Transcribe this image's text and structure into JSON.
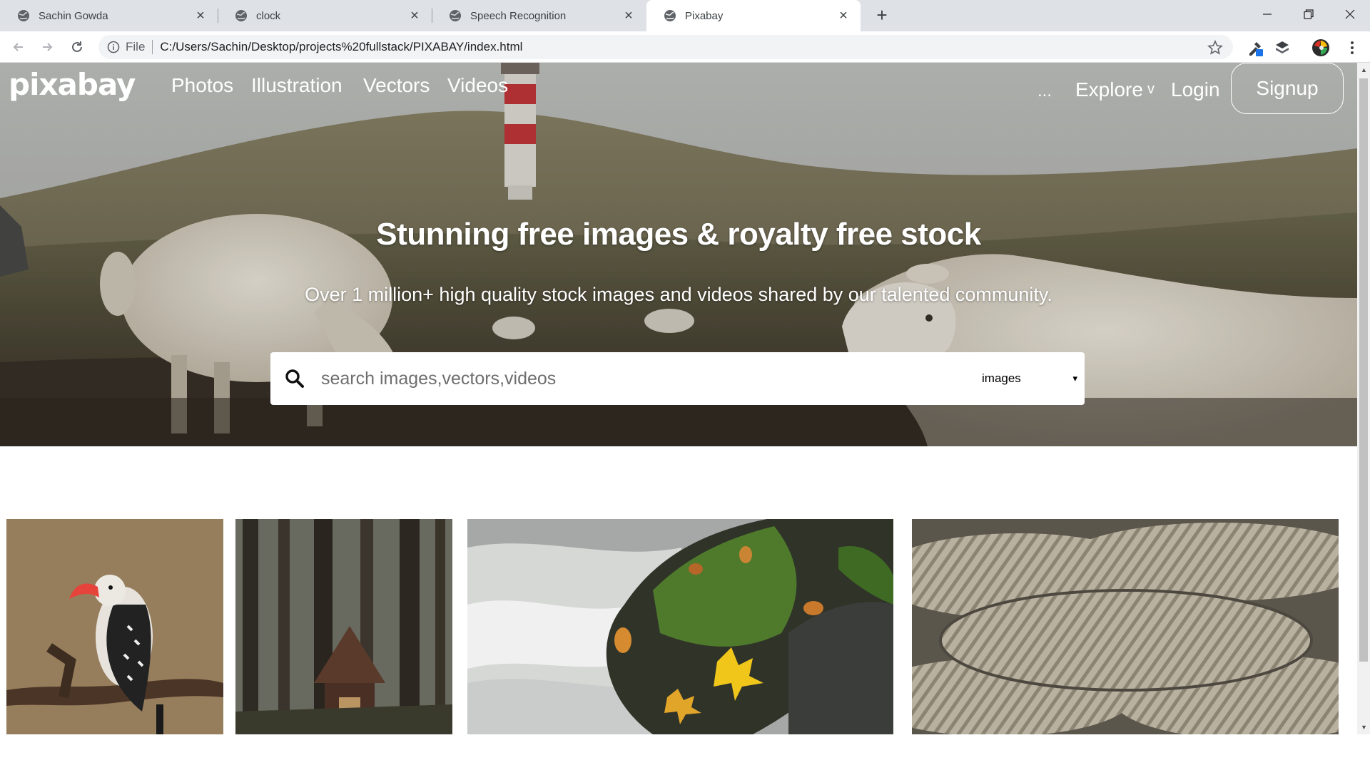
{
  "browser": {
    "tabs": [
      {
        "title": "Sachin Gowda",
        "active": false
      },
      {
        "title": "clock",
        "active": false
      },
      {
        "title": "Speech Recognition",
        "active": false
      },
      {
        "title": "Pixabay",
        "active": true
      }
    ],
    "address": {
      "scheme_label": "File",
      "url": "C:/Users/Sachin/Desktop/projects%20fullstack/PIXABAY/index.html"
    }
  },
  "page": {
    "logo": "pixabay",
    "nav": {
      "photos": "Photos",
      "illustration": "Illustration",
      "vectors": "Vectors",
      "videos": "Videos",
      "more": "...",
      "explore": "Explore",
      "explore_caret": "v",
      "login": "Login",
      "signup": "Signup"
    },
    "hero": {
      "title": "Stunning free images & royalty free stock",
      "subtitle": "Over 1 million+ high quality stock images and videos shared by our talented community."
    },
    "search": {
      "placeholder": "search images,vectors,videos",
      "type_selected": "images",
      "type_caret": "▾"
    },
    "gallery": [
      {
        "subject": "hornbill-bird"
      },
      {
        "subject": "forest-cabin"
      },
      {
        "subject": "mossy-rock-waterfall"
      },
      {
        "subject": "rope-knot"
      }
    ]
  },
  "colors": {
    "tabstrip": "#dee1e6",
    "omnibox": "#f1f3f4",
    "taskbar": "#0f1c2a",
    "lighthouse_red": "#c8373a"
  }
}
